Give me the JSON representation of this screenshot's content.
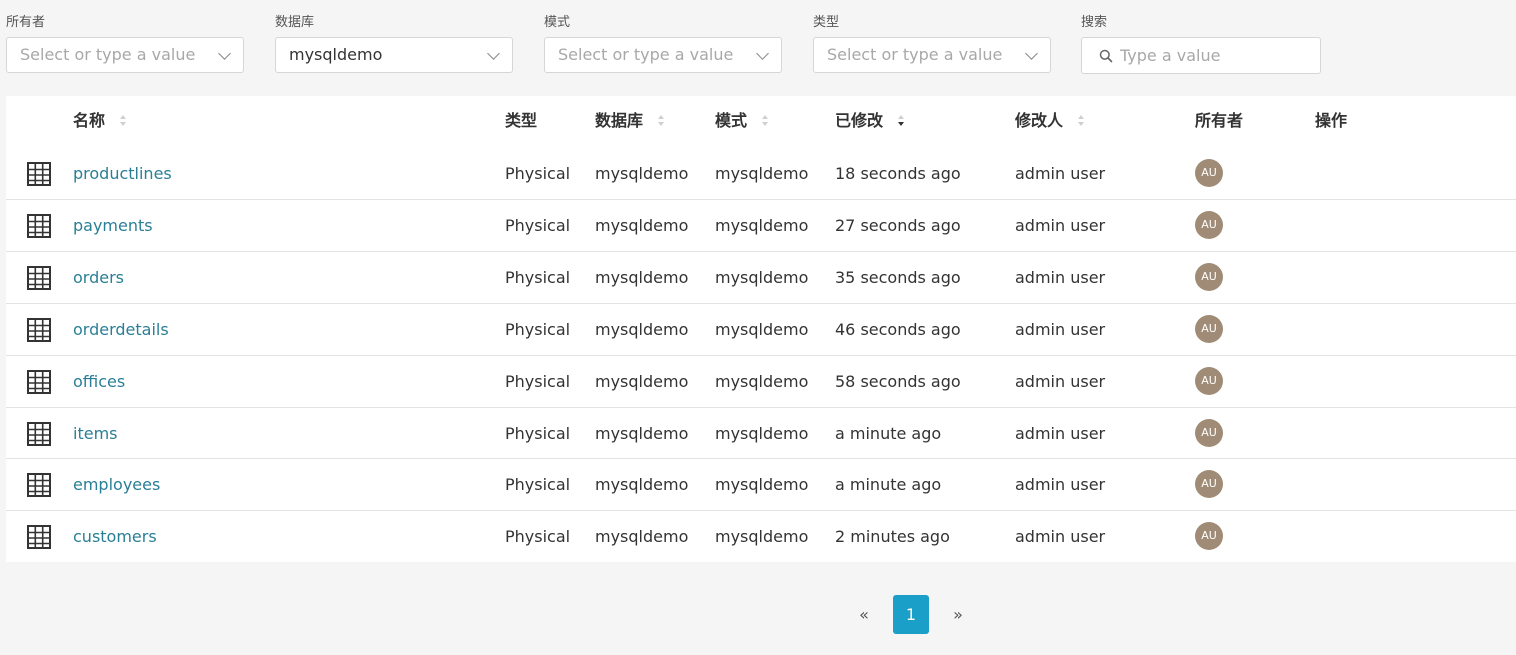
{
  "filters": {
    "owner": {
      "label": "所有者",
      "placeholder": "Select or type a value"
    },
    "database": {
      "label": "数据库",
      "value": "mysqldemo"
    },
    "schema": {
      "label": "模式",
      "placeholder": "Select or type a value"
    },
    "type": {
      "label": "类型",
      "placeholder": "Select or type a value"
    },
    "search": {
      "label": "搜索",
      "placeholder": "Type a value"
    }
  },
  "table": {
    "headers": {
      "name": "名称",
      "type": "类型",
      "database": "数据库",
      "schema": "模式",
      "modified": "已修改",
      "modified_by": "修改人",
      "owner": "所有者",
      "actions": "操作"
    },
    "rows": [
      {
        "name": "productlines",
        "type": "Physical",
        "database": "mysqldemo",
        "schema": "mysqldemo",
        "modified": "18 seconds ago",
        "modified_by": "admin user",
        "owner": "AU"
      },
      {
        "name": "payments",
        "type": "Physical",
        "database": "mysqldemo",
        "schema": "mysqldemo",
        "modified": "27 seconds ago",
        "modified_by": "admin user",
        "owner": "AU"
      },
      {
        "name": "orders",
        "type": "Physical",
        "database": "mysqldemo",
        "schema": "mysqldemo",
        "modified": "35 seconds ago",
        "modified_by": "admin user",
        "owner": "AU"
      },
      {
        "name": "orderdetails",
        "type": "Physical",
        "database": "mysqldemo",
        "schema": "mysqldemo",
        "modified": "46 seconds ago",
        "modified_by": "admin user",
        "owner": "AU"
      },
      {
        "name": "offices",
        "type": "Physical",
        "database": "mysqldemo",
        "schema": "mysqldemo",
        "modified": "58 seconds ago",
        "modified_by": "admin user",
        "owner": "AU"
      },
      {
        "name": "items",
        "type": "Physical",
        "database": "mysqldemo",
        "schema": "mysqldemo",
        "modified": "a minute ago",
        "modified_by": "admin user",
        "owner": "AU"
      },
      {
        "name": "employees",
        "type": "Physical",
        "database": "mysqldemo",
        "schema": "mysqldemo",
        "modified": "a minute ago",
        "modified_by": "admin user",
        "owner": "AU"
      },
      {
        "name": "customers",
        "type": "Physical",
        "database": "mysqldemo",
        "schema": "mysqldemo",
        "modified": "2 minutes ago",
        "modified_by": "admin user",
        "owner": "AU"
      }
    ]
  },
  "pagination": {
    "prev": "«",
    "current": "1",
    "next": "»"
  },
  "colors": {
    "link": "#2a7f96",
    "accent": "#1a9fc8",
    "avatar": "#a08c76"
  },
  "icons": {
    "row": "table-grid-icon",
    "search": "search-icon",
    "dropdown": "chevron-down-icon"
  }
}
